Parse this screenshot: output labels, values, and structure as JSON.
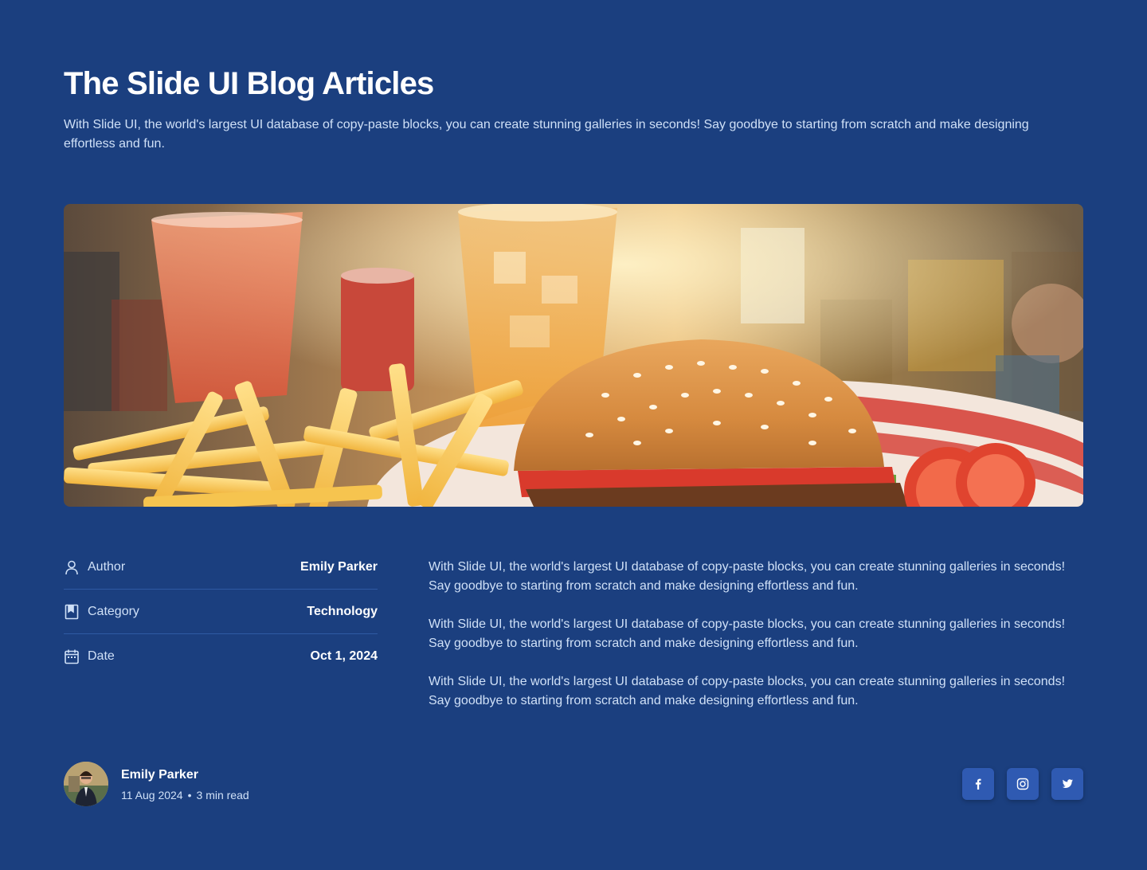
{
  "header": {
    "title": "The Slide UI Blog Articles",
    "subtitle": "With Slide UI, the world's largest UI database of copy-paste blocks, you can create stunning galleries in seconds! Say goodbye to starting from scratch and make designing effortless and fun."
  },
  "hero": {
    "icon": "burger-and-fries-photo"
  },
  "meta": {
    "rows": [
      {
        "icon": "user-icon",
        "label": "Author",
        "value": "Emily Parker"
      },
      {
        "icon": "bookmark-icon",
        "label": "Category",
        "value": "Technology"
      },
      {
        "icon": "calendar-icon",
        "label": "Date",
        "value": "Oct 1, 2024"
      }
    ]
  },
  "article": {
    "paragraphs": [
      "With Slide UI, the world's largest UI database of copy-paste blocks, you can create stunning galleries in seconds! Say goodbye to starting from scratch and make designing effortless and fun.",
      "With Slide UI, the world's largest UI database of copy-paste blocks, you can create stunning galleries in seconds! Say goodbye to starting from scratch and make designing effortless and fun.",
      "With Slide UI, the world's largest UI database of copy-paste blocks, you can create stunning galleries in seconds! Say goodbye to starting from scratch and make designing effortless and fun."
    ]
  },
  "footer": {
    "author_name": "Emily Parker",
    "date": "11 Aug 2024",
    "separator": "•",
    "read_time": "3 min read",
    "socials": [
      {
        "icon": "facebook-icon"
      },
      {
        "icon": "instagram-icon"
      },
      {
        "icon": "twitter-icon"
      }
    ]
  },
  "colors": {
    "background": "#1b3f7f",
    "text_muted": "#cfe0f7",
    "divider": "#2f5aa3",
    "social_button": "#2f5ab2"
  }
}
